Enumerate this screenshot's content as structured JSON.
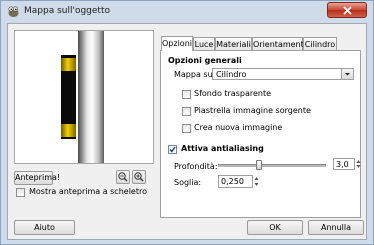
{
  "window": {
    "title": "Mappa sull'oggetto"
  },
  "preview": {
    "preview_button": "Anteprima!",
    "wireframe_checkbox": {
      "label": "Mostra anteprima a scheletro",
      "checked": false
    }
  },
  "tabs": [
    {
      "label": "Opzioni",
      "active": true
    },
    {
      "label": "Luce",
      "active": false
    },
    {
      "label": "Materiali",
      "active": false
    },
    {
      "label": "Orientamento",
      "active": false
    },
    {
      "label": "Cilindro",
      "active": false
    }
  ],
  "options": {
    "section_title": "Opzioni generali",
    "map_to_label": "Mappa su:",
    "map_to_value": "Cilindro",
    "checkboxes": [
      {
        "label": "Sfondo trasparente",
        "checked": false
      },
      {
        "label": "Piastrella immagine sorgente",
        "checked": false
      },
      {
        "label": "Crea nuova immagine",
        "checked": false
      }
    ],
    "antialiasing": {
      "label": "Attiva antialiasing",
      "checked": true
    },
    "depth": {
      "label": "Profondità:",
      "value": "3,0",
      "slider_fraction": 0.37
    },
    "threshold": {
      "label": "Soglia:",
      "value": "0,250"
    }
  },
  "buttons": {
    "help": "Aiuto",
    "ok": "OK",
    "cancel": "Annulla"
  }
}
